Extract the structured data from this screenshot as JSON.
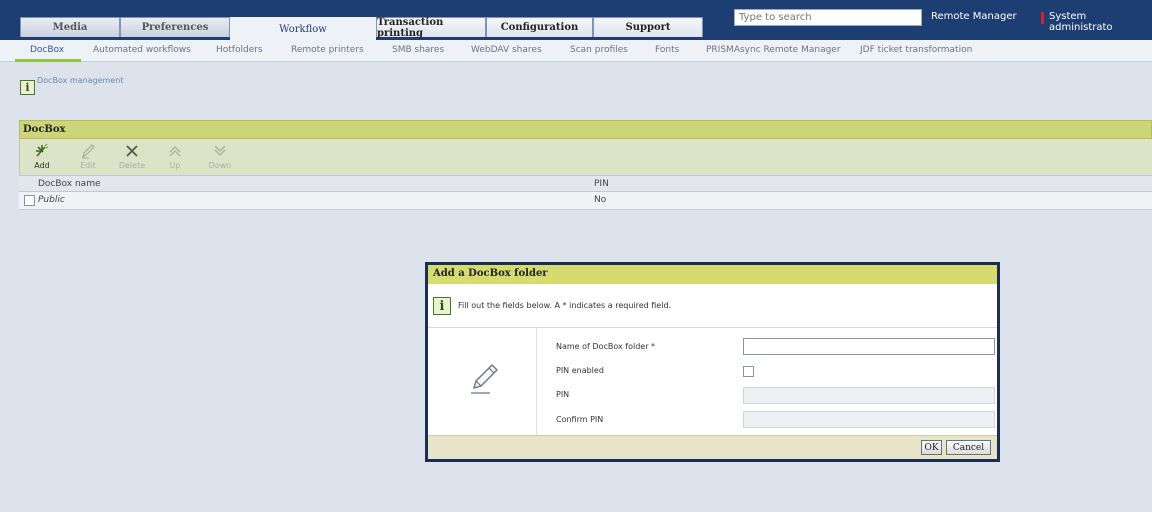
{
  "main_tabs": [
    {
      "label": "Media",
      "state": "normal"
    },
    {
      "label": "Preferences",
      "state": "normal"
    },
    {
      "label": "Workflow",
      "state": "active"
    },
    {
      "label": "Transaction printing",
      "state": "alt"
    },
    {
      "label": "Configuration",
      "state": "alt"
    },
    {
      "label": "Support",
      "state": "alt"
    }
  ],
  "search": {
    "placeholder": "Type to search"
  },
  "header": {
    "remote_manager": "Remote Manager",
    "user": "System administrato"
  },
  "sub_nav": [
    {
      "label": "DocBox",
      "active": true
    },
    {
      "label": "Automated workflows"
    },
    {
      "label": "Hotfolders"
    },
    {
      "label": "Remote printers"
    },
    {
      "label": "SMB shares"
    },
    {
      "label": "WebDAV shares"
    },
    {
      "label": "Scan profiles"
    },
    {
      "label": "Fonts"
    },
    {
      "label": "PRISMAsync Remote Manager"
    },
    {
      "label": "JDF ticket transformation"
    }
  ],
  "page": {
    "info_icon": "i",
    "breadcrumb": "DocBox management"
  },
  "docbox": {
    "title": "DocBox",
    "toolbar": [
      {
        "label": "Add",
        "icon": "add-icon",
        "enabled": true
      },
      {
        "label": "Edit",
        "icon": "edit-icon",
        "enabled": false
      },
      {
        "label": "Delete",
        "icon": "delete-icon",
        "enabled": false
      },
      {
        "label": "Up",
        "icon": "up-icon",
        "enabled": false
      },
      {
        "label": "Down",
        "icon": "down-icon",
        "enabled": false
      }
    ],
    "columns": [
      "DocBox name",
      "PIN"
    ],
    "rows": [
      {
        "name": "Public",
        "pin": "No"
      }
    ]
  },
  "dialog": {
    "title": "Add a DocBox folder",
    "info_icon": "i",
    "message": "Fill out the fields below. A * indicates a required field.",
    "fields": {
      "name_label": "Name of DocBox folder *",
      "name_value": "",
      "pin_enabled_label": "PIN enabled",
      "pin_label": "PIN",
      "confirm_pin_label": "Confirm PIN"
    },
    "ok_label": "OK",
    "cancel_label": "Cancel"
  },
  "colors": {
    "topbar": "#1d3e73",
    "panel_header": "#ccd577",
    "dialog_header": "#d6db6d",
    "accent": "#8fc64a"
  }
}
